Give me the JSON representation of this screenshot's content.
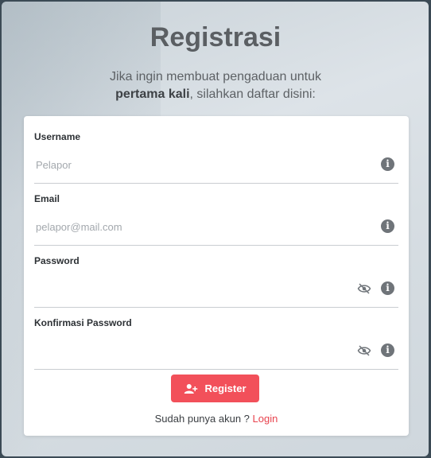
{
  "header": {
    "title": "Registrasi",
    "subtitle_line1": "Jika ingin membuat pengaduan untuk",
    "subtitle_bold": "pertama kali",
    "subtitle_rest": ", silahkan daftar disini:"
  },
  "form": {
    "username": {
      "label": "Username",
      "placeholder": "Pelapor",
      "value": ""
    },
    "email": {
      "label": "Email",
      "placeholder": "pelapor@mail.com",
      "value": ""
    },
    "password": {
      "label": "Password",
      "placeholder": "",
      "value": ""
    },
    "confirm_password": {
      "label": "Konfirmasi Password",
      "placeholder": "",
      "value": ""
    },
    "register_label": "Register",
    "login_prompt": "Sudah punya akun ? ",
    "login_link": "Login"
  },
  "icons": {
    "info": "info-circle-icon",
    "eye": "eye-slash-icon",
    "register": "user-plus-icon"
  },
  "colors": {
    "accent": "#f2505a",
    "link": "#e8434e",
    "title": "#5b5f63"
  }
}
